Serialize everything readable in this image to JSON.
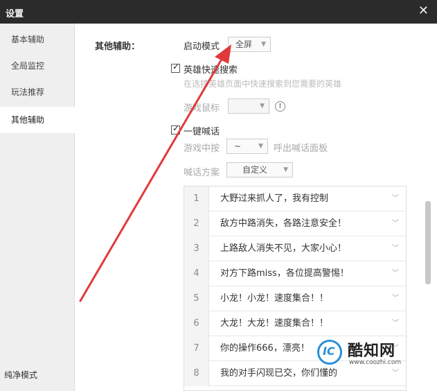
{
  "window": {
    "title": "设置",
    "close_glyph": "✕"
  },
  "sidebar": {
    "items": [
      {
        "label": "基本辅助"
      },
      {
        "label": "全局监控"
      },
      {
        "label": "玩法推荐"
      },
      {
        "label": "其他辅助"
      }
    ],
    "active_index": 3,
    "footer_label": "纯净模式"
  },
  "main": {
    "section_label": "其他辅助：",
    "launch_mode": {
      "label": "启动模式",
      "value": "全屏"
    },
    "quick_search": {
      "label": "英雄快速搜索",
      "checked": true,
      "hint": "在选择英雄页面中快速搜索到您需要的英雄"
    },
    "game_cursor": {
      "label": "游戏鼠标",
      "value": "",
      "info_glyph": "!"
    },
    "quick_shout": {
      "label": "一键喊话",
      "checked": true,
      "hotkey_label": "游戏中按",
      "hotkey_value": "~",
      "hotkey_suffix": "呼出喊话面板",
      "scheme_label": "喊话方案",
      "scheme_value": "自定义"
    },
    "phrases": [
      {
        "num": "1",
        "text": "大野过来抓人了，我有控制"
      },
      {
        "num": "2",
        "text": "敌方中路消失，各路注意安全！"
      },
      {
        "num": "3",
        "text": "上路敌人消失不见，大家小心！"
      },
      {
        "num": "4",
        "text": "对方下路miss，各位提高警惕！"
      },
      {
        "num": "5",
        "text": "小龙！小龙！速度集合！！"
      },
      {
        "num": "6",
        "text": "大龙！大龙！速度集合！！"
      },
      {
        "num": "7",
        "text": "你的操作666，漂亮！"
      },
      {
        "num": "8",
        "text": "我的对手闪现已交，你们懂的"
      }
    ]
  },
  "watermark": {
    "name": "酷知网",
    "url": "www.coozhi.com",
    "logo_glyph": "IC"
  },
  "colors": {
    "titlebar": "#2b2b2b",
    "arrow": "#e0393b",
    "sidebar_bg": "#efefef",
    "watermark_blue": "#2a8fd8"
  }
}
